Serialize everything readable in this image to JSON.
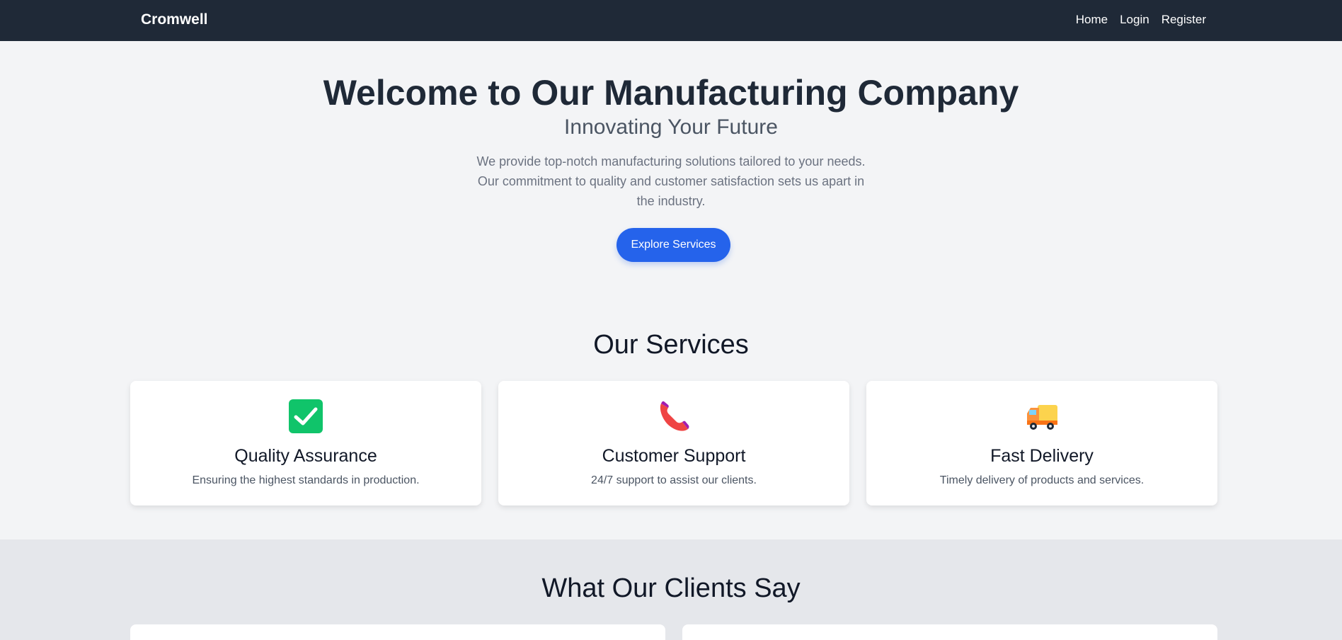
{
  "nav": {
    "brand": "Cromwell",
    "links": [
      "Home",
      "Login",
      "Register"
    ]
  },
  "hero": {
    "title": "Welcome to Our Manufacturing Company",
    "subtitle": "Innovating Your Future",
    "description": "We provide top-notch manufacturing solutions tailored to your needs. Our commitment to quality and customer satisfaction sets us apart in the industry.",
    "button_label": "Explore Services"
  },
  "services": {
    "title": "Our Services",
    "items": [
      {
        "icon": "check-mark-icon",
        "name": "Quality Assurance",
        "description": "Ensuring the highest standards in production."
      },
      {
        "icon": "phone-icon",
        "name": "Customer Support",
        "description": "24/7 support to assist our clients."
      },
      {
        "icon": "delivery-truck-icon",
        "name": "Fast Delivery",
        "description": "Timely delivery of products and services."
      }
    ]
  },
  "testimonials": {
    "title": "What Our Clients Say"
  },
  "colors": {
    "navbar": "#1f2937",
    "accent": "#2563eb",
    "page_bg": "#f3f4f6",
    "testimonials_bg": "#e5e7eb"
  }
}
